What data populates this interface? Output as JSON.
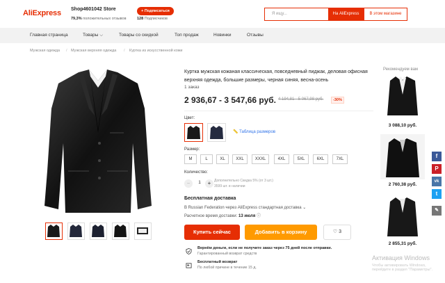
{
  "header": {
    "logo": "AliExpress",
    "store_name": "Shop4601042 Store",
    "store_verified": "•",
    "rating_value": "79,3%",
    "rating_text": "положительных отзывов",
    "follow_label": "+ Подписаться",
    "followers_value": "128",
    "followers_text": "Подписчиков",
    "search_placeholder": "Я ищу...",
    "search_aliexpress": "На AliExpress",
    "search_store": "В этом магазине"
  },
  "nav": {
    "items": [
      "Главная страница",
      "Товары",
      "Товары со скидкой",
      "Топ продаж",
      "Новинки",
      "Отзывы"
    ]
  },
  "breadcrumb": [
    "Мужская одежда",
    "Мужская верхняя одежда",
    "Куртка из искусственной кожи"
  ],
  "product": {
    "title": "Куртка мужская кожаная классическая, повседневный пиджак, деловая офисная верхняя одежда, большие размеры, черная синяя, весна-осень",
    "orders": "1 заказ",
    "price": "2 936,67 - 3 547,66 руб.",
    "old_price": "4 194,81 - 5 067,98 руб.",
    "discount": "-30%",
    "color_label": "Цвет:",
    "size_guide": "Таблица размеров",
    "size_label": "Размер:",
    "sizes": [
      "M",
      "L",
      "XL",
      "XXL",
      "XXXL",
      "4XL",
      "5XL",
      "6XL",
      "7XL"
    ],
    "qty_label": "Количество:",
    "qty_value": "1",
    "qty_minus": "−",
    "qty_plus": "+",
    "qty_note_1": "Дополнительно Скидка 5% (от 3 шт.)",
    "qty_note_2": "3599 шт. в наличии"
  },
  "shipping": {
    "title": "Бесплатная доставка",
    "line": "В Russian Federation через AliExpress стандартная доставка ⌄",
    "date_label": "Расчетное время доставки:",
    "date_value": "13 июля"
  },
  "actions": {
    "buy_now": "Купить сейчас",
    "add_to_cart": "Добавить в корзину",
    "wishlist_count": "3"
  },
  "guarantees": [
    {
      "title": "Вернём деньги, если не получите заказ через 75 дней после отправки.",
      "sub": "Гарантированный возврат средств"
    },
    {
      "title": "Бесплатный возврат",
      "sub": "По любой причине в течение 15 д."
    }
  ],
  "recommended": {
    "title": "Рекомендуем вам",
    "items": [
      {
        "price": "3 088,10 руб."
      },
      {
        "price": "2 760,38 руб."
      },
      {
        "price": "2 855,31 руб."
      }
    ]
  },
  "social": [
    "f",
    "P",
    "vk",
    "t",
    "✎"
  ],
  "watermark": {
    "line1": "Активация Windows",
    "line2": "Чтобы активировать Windows, перейдите в раздел \"Параметры\"."
  },
  "colors": {
    "accent": "#e62e04",
    "cart": "#ff9a00",
    "link": "#2f72e8"
  }
}
